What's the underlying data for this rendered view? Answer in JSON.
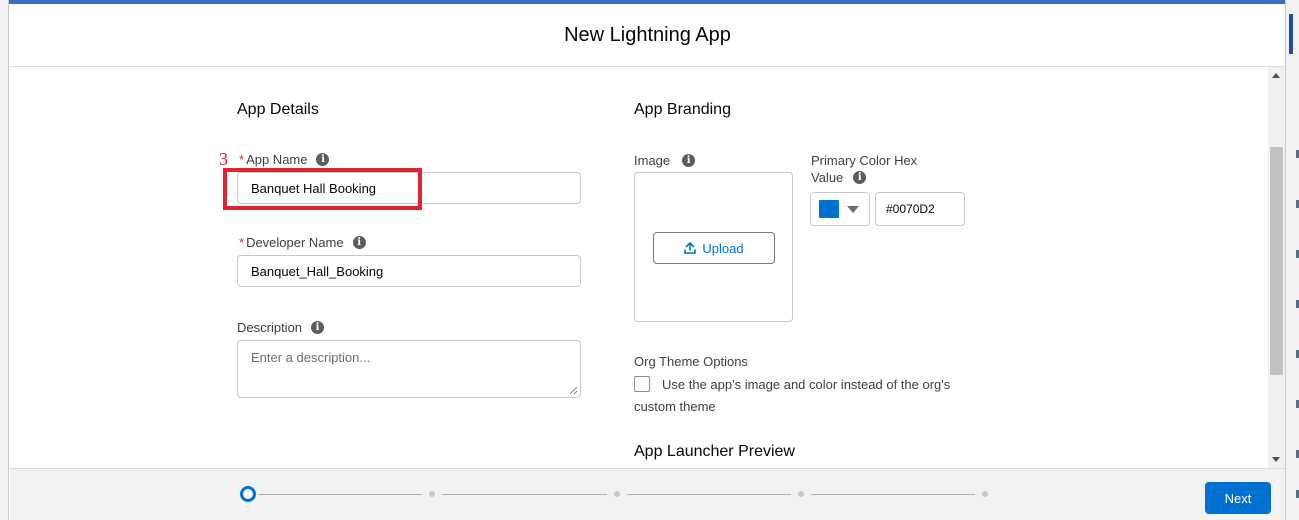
{
  "modal": {
    "title": "New Lightning App",
    "step_number": "3"
  },
  "app_details": {
    "section_title": "App Details",
    "app_name": {
      "required_mark": "*",
      "label": "App Name",
      "value": "Banquet Hall Booking"
    },
    "developer_name": {
      "required_mark": "*",
      "label": "Developer Name",
      "value": "Banquet_Hall_Booking"
    },
    "description": {
      "label": "Description",
      "placeholder": "Enter a description..."
    }
  },
  "app_branding": {
    "section_title": "App Branding",
    "image_label": "Image",
    "upload_label": "Upload",
    "primary_color_label_line1": "Primary Color Hex",
    "primary_color_label_line2": "Value",
    "primary_color_value": "#0070D2",
    "swatch_color": "#0070d2",
    "org_theme_title": "Org Theme Options",
    "org_theme_checkbox_line1": "Use the app's image and color instead of the org's",
    "org_theme_checkbox_line2": "custom theme",
    "org_theme_checked": false,
    "launcher_preview_title": "App Launcher Preview"
  },
  "info_icon_glyph": "i",
  "footer": {
    "next_label": "Next",
    "steps_total": 5,
    "current_step": 1
  }
}
